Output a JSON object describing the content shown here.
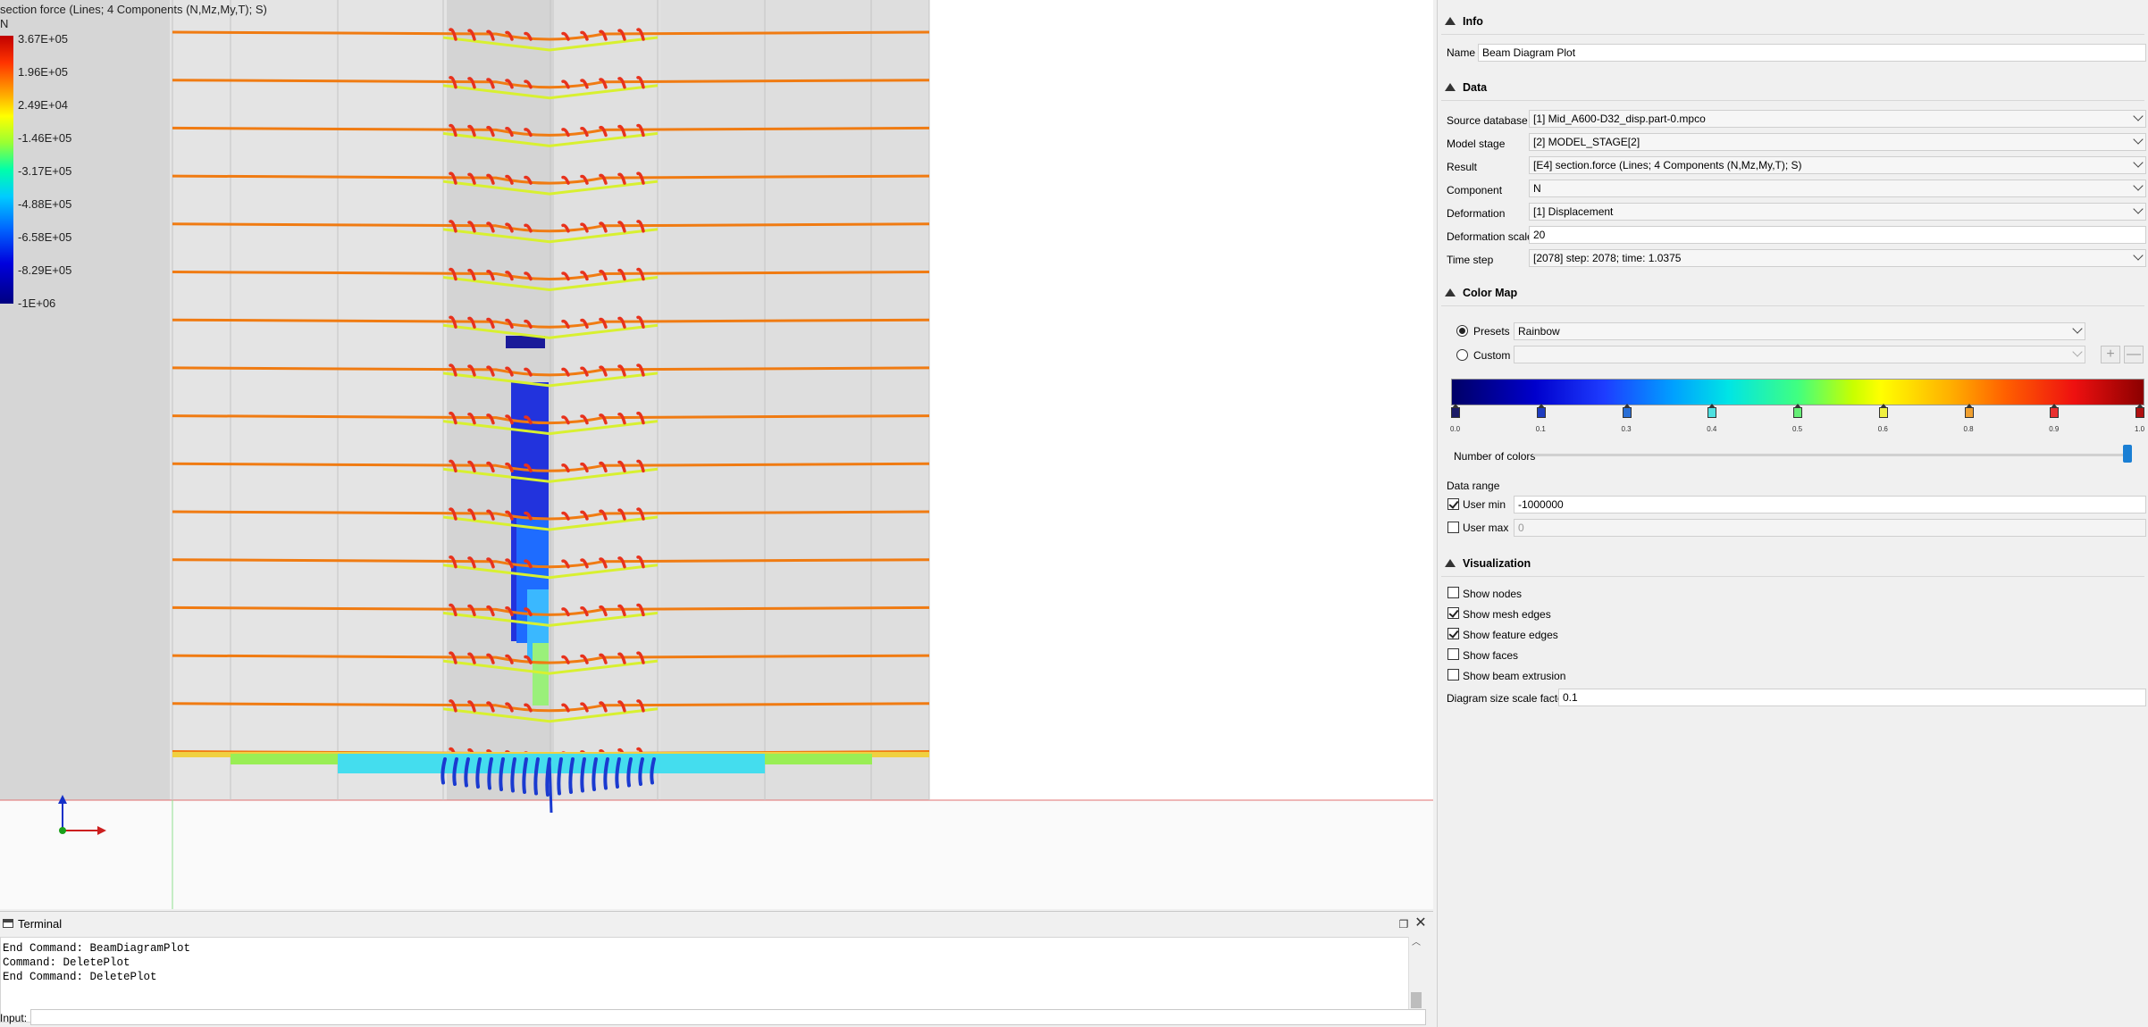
{
  "viewport": {
    "title": "section force (Lines; 4 Components (N,Mz,My,T); S)",
    "component": "N",
    "legend": [
      "3.67E+05",
      "1.96E+05",
      "2.49E+04",
      "-1.46E+05",
      "-3.17E+05",
      "-4.88E+05",
      "-6.58E+05",
      "-8.29E+05",
      "-1E+06"
    ]
  },
  "terminal": {
    "title": "Terminal",
    "lines": [
      "End Command: BeamDiagramPlot",
      "Command: DeletePlot",
      "End Command: DeletePlot"
    ],
    "input_label": "Input:",
    "input_value": ""
  },
  "panel": {
    "info": {
      "header": "Info",
      "name_label": "Name",
      "name_value": "Beam Diagram Plot"
    },
    "data": {
      "header": "Data",
      "source_db_label": "Source database",
      "source_db_value": "[1] Mid_A600-D32_disp.part-0.mpco",
      "model_stage_label": "Model stage",
      "model_stage_value": "[2] MODEL_STAGE[2]",
      "result_label": "Result",
      "result_value": "[E4] section.force (Lines; 4 Components (N,Mz,My,T); S)",
      "component_label": "Component",
      "component_value": "N",
      "deformation_label": "Deformation",
      "deformation_value": "[1] Displacement",
      "deformation_scale_label": "Deformation scale",
      "deformation_scale_value": "20",
      "time_step_label": "Time step",
      "time_step_value": "[2078] step: 2078; time: 1.0375"
    },
    "colormap": {
      "header": "Color Map",
      "presets_label": "Presets",
      "presets_value": "Rainbow",
      "presets_selected": true,
      "custom_label": "Custom",
      "custom_value": "",
      "stop_labels": [
        "0.0",
        "0.1",
        "0.3",
        "0.4",
        "0.5",
        "0.6",
        "0.8",
        "0.9",
        "1.0"
      ],
      "stop_colors": [
        "#1a1a66",
        "#1e3cbf",
        "#2a6fd6",
        "#4ee0e0",
        "#66ee77",
        "#f0f040",
        "#f0a030",
        "#e83030",
        "#b01010"
      ],
      "num_colors_label": "Number of colors",
      "num_colors_level": 1.0,
      "data_range_label": "Data range",
      "user_min_label": "User min",
      "user_min_checked": true,
      "user_min_value": "-1000000",
      "user_max_label": "User max",
      "user_max_checked": false,
      "user_max_value": "0"
    },
    "visualization": {
      "header": "Visualization",
      "show_nodes": "Show nodes",
      "show_nodes_checked": false,
      "show_mesh_edges": "Show mesh edges",
      "show_mesh_edges_checked": true,
      "show_feature_edges": "Show feature edges",
      "show_feature_edges_checked": true,
      "show_faces": "Show faces",
      "show_faces_checked": false,
      "show_beam_extrusion": "Show beam extrusion",
      "show_beam_extrusion_checked": false,
      "diagram_scale_label": "Diagram size scale factor",
      "diagram_scale_value": "0.1"
    }
  }
}
